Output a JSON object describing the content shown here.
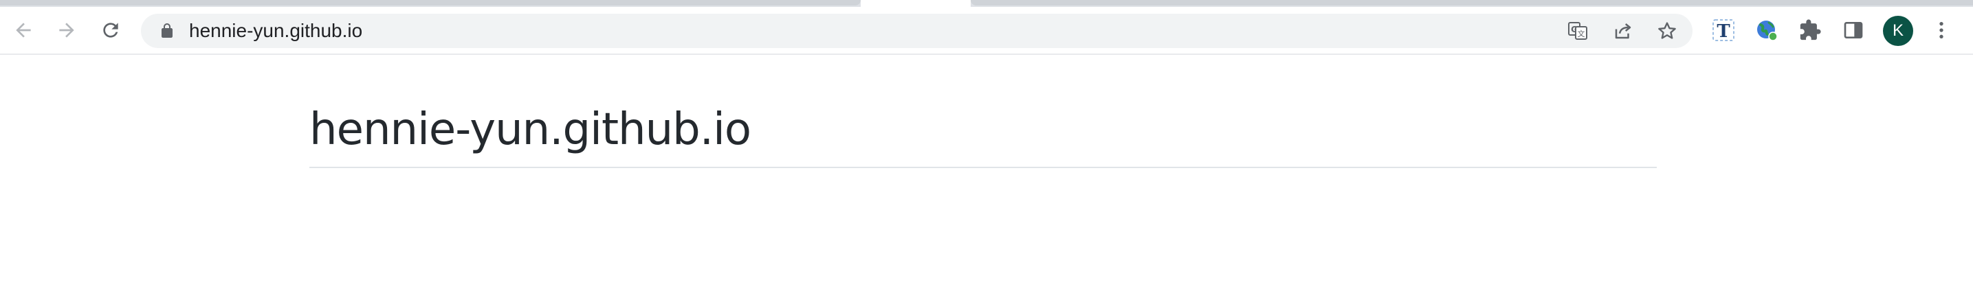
{
  "browser": {
    "address_bar": {
      "url": "hennie-yun.github.io"
    },
    "profile": {
      "initial": "K",
      "avatar_color": "#0b5345"
    },
    "toolbar_icons": [
      "back-icon",
      "forward-icon",
      "reload-icon",
      "lock-icon",
      "translate-icon",
      "share-icon",
      "bookmark-star-icon",
      "extension-t-icon",
      "extension-globe-icon",
      "extensions-puzzle-icon",
      "side-panel-icon",
      "menu-icon"
    ]
  },
  "page": {
    "title": "hennie-yun.github.io"
  }
}
